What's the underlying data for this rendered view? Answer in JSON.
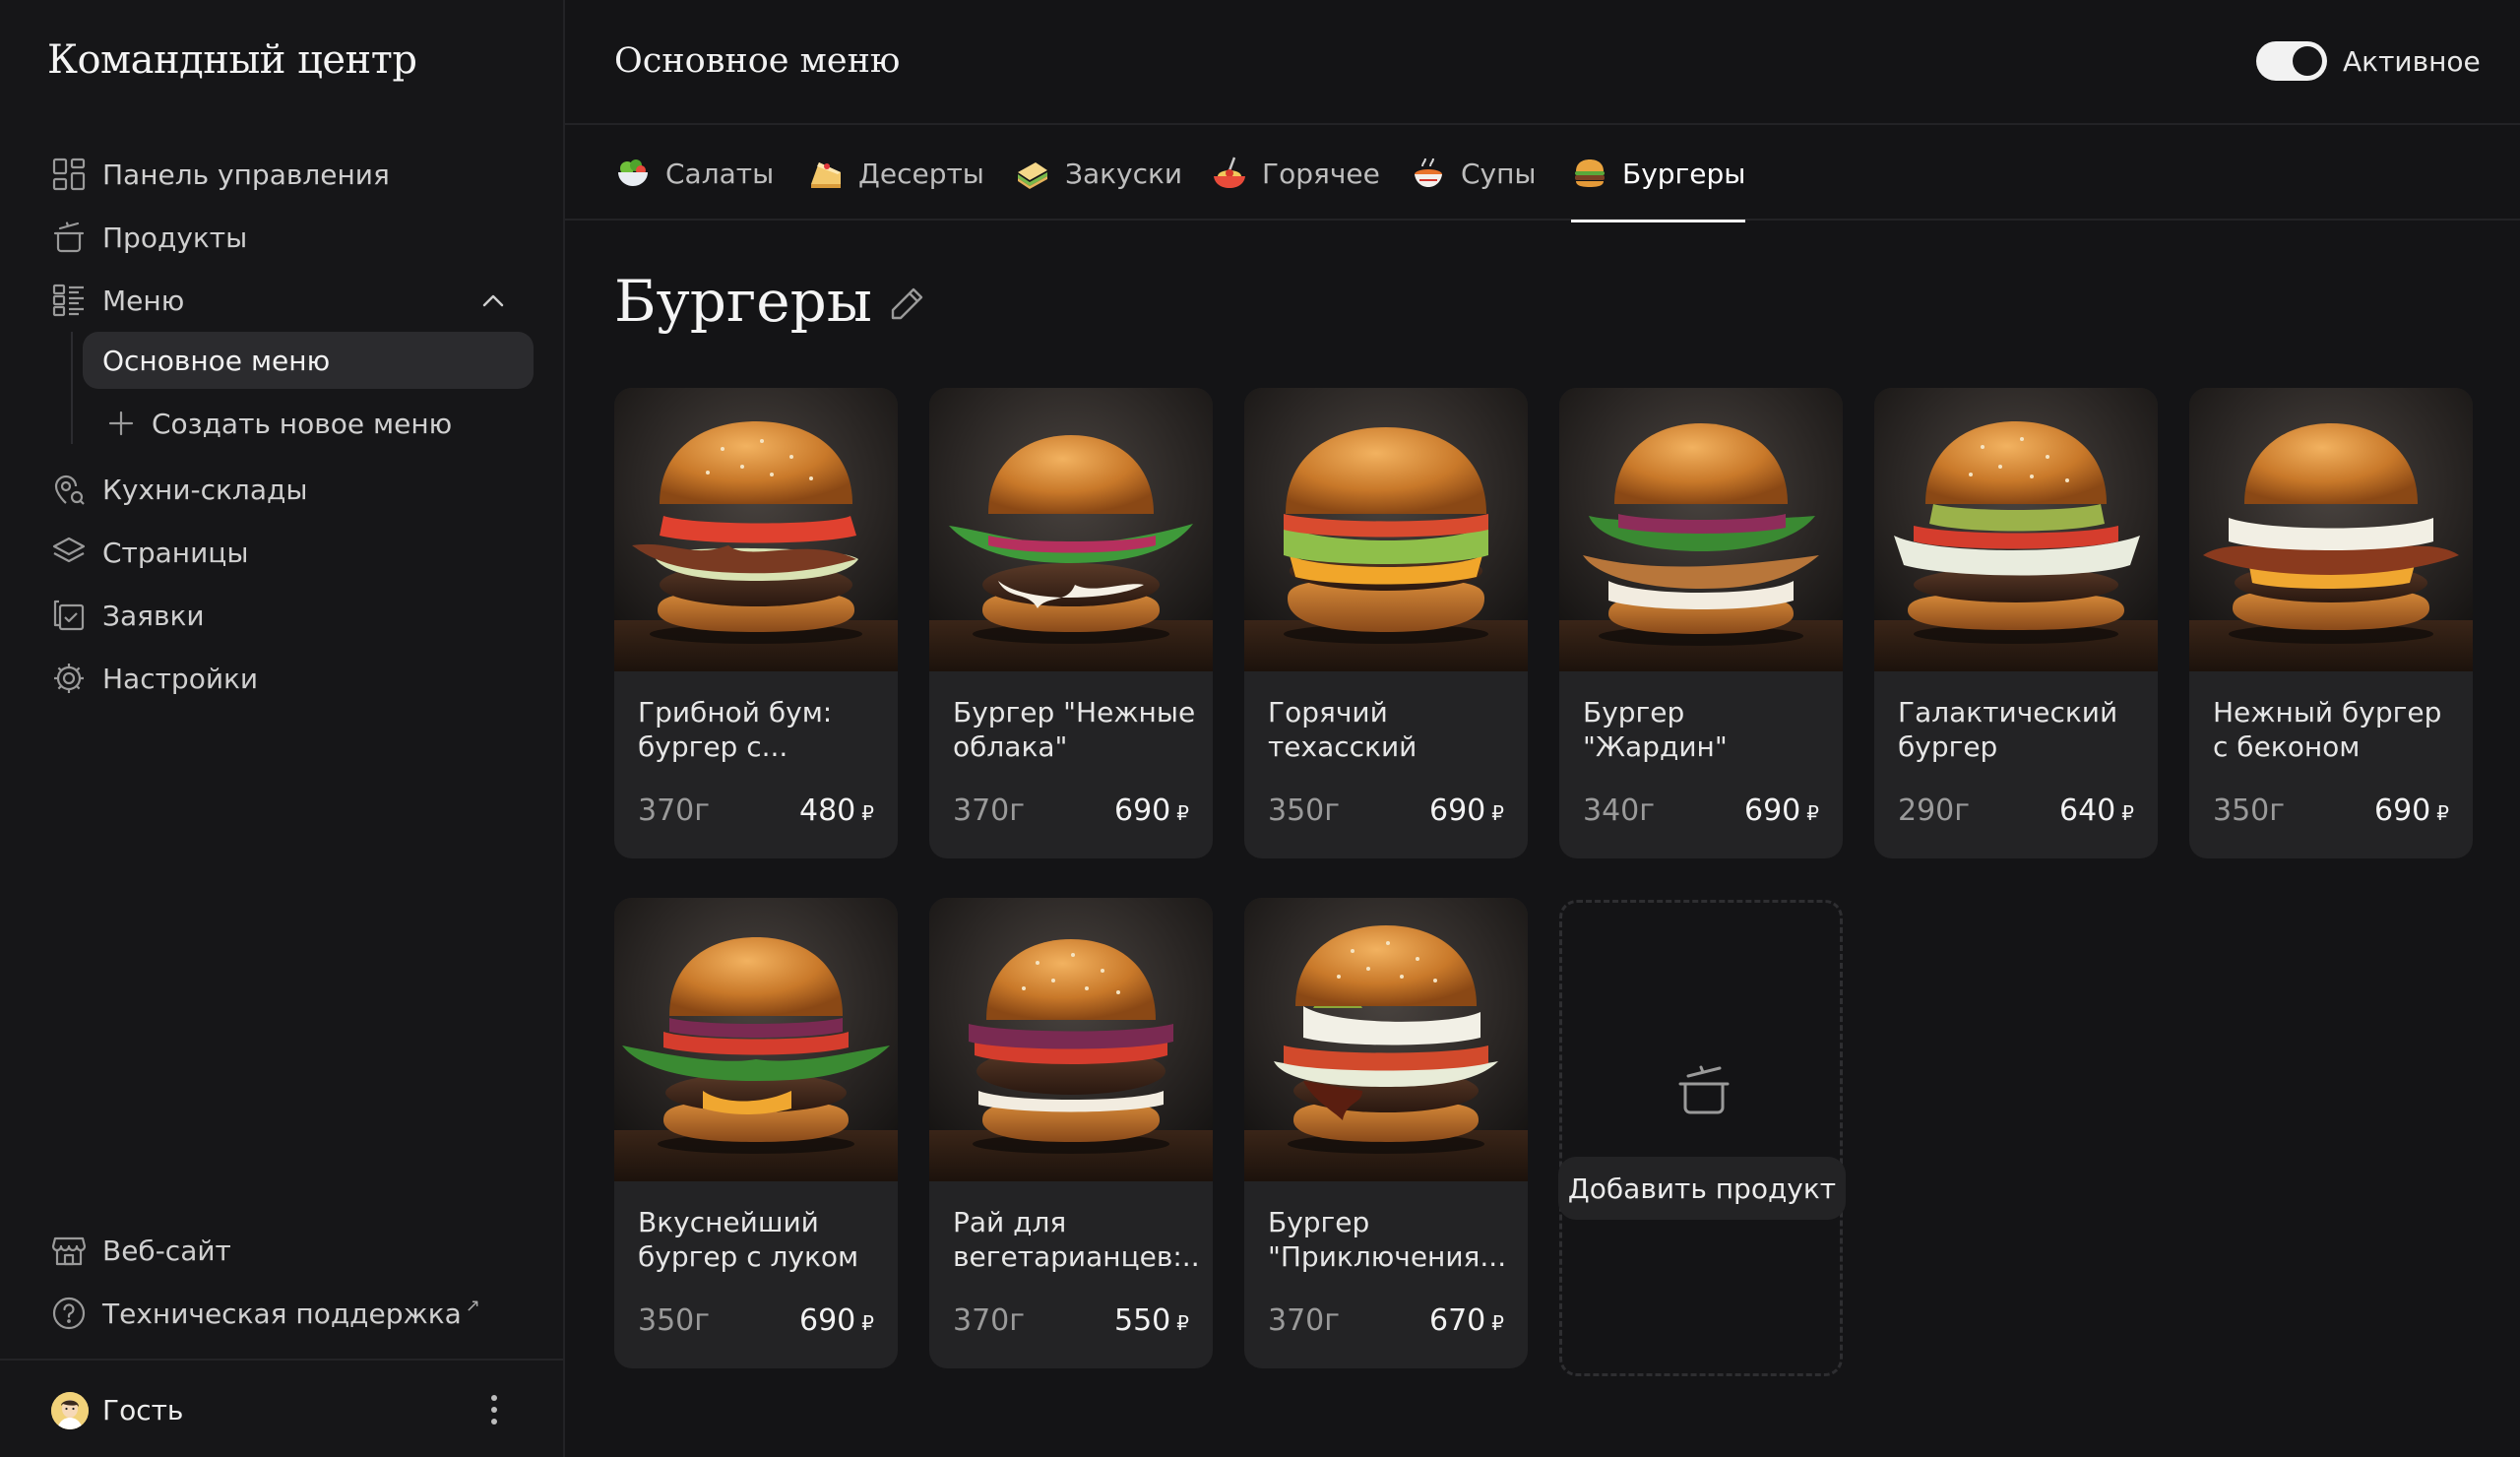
{
  "sidebar": {
    "brand": "Командный центр",
    "items": [
      {
        "label": "Панель управления"
      },
      {
        "label": "Продукты"
      },
      {
        "label": "Меню"
      }
    ],
    "submenu": [
      {
        "label": "Основное меню"
      },
      {
        "label": "Создать новое меню"
      }
    ],
    "items2": [
      {
        "label": "Кухни-склады"
      },
      {
        "label": "Страницы"
      },
      {
        "label": "Заявки"
      },
      {
        "label": "Настройки"
      }
    ],
    "bottom": [
      {
        "label": "Веб-сайт"
      },
      {
        "label": "Техническая поддержка",
        "suffix": "↗"
      }
    ],
    "user": "Гость"
  },
  "header": {
    "title": "Основное меню",
    "toggle_label": "Активное",
    "toggle_on": true
  },
  "tabs": [
    {
      "label": "Салаты"
    },
    {
      "label": "Десерты"
    },
    {
      "label": "Закуски"
    },
    {
      "label": "Горячее"
    },
    {
      "label": "Супы"
    },
    {
      "label": "Бургеры",
      "active": true
    }
  ],
  "section": {
    "title": "Бургеры"
  },
  "products": [
    {
      "name": "Грибной бум: бургер с...",
      "weight": "370г",
      "price": "480",
      "currency": "₽"
    },
    {
      "name": "Бургер \"Нежные облака\"",
      "weight": "370г",
      "price": "690",
      "currency": "₽"
    },
    {
      "name": "Горячий техасский бургер",
      "weight": "350г",
      "price": "690",
      "currency": "₽"
    },
    {
      "name": "Бургер \"Жардин\"",
      "weight": "340г",
      "price": "690",
      "currency": "₽"
    },
    {
      "name": "Галактический бургер",
      "weight": "290г",
      "price": "640",
      "currency": "₽"
    },
    {
      "name": "Нежный бургер с беконом",
      "weight": "350г",
      "price": "690",
      "currency": "₽"
    },
    {
      "name": "Вкуснейший бургер с луком",
      "weight": "350г",
      "price": "690",
      "currency": "₽"
    },
    {
      "name": "Рай для вегетарианцев:...",
      "weight": "370г",
      "price": "550",
      "currency": "₽"
    },
    {
      "name": "Бургер \"Приключения...",
      "weight": "370г",
      "price": "670",
      "currency": "₽"
    }
  ],
  "add_product_label": "Добавить продукт"
}
